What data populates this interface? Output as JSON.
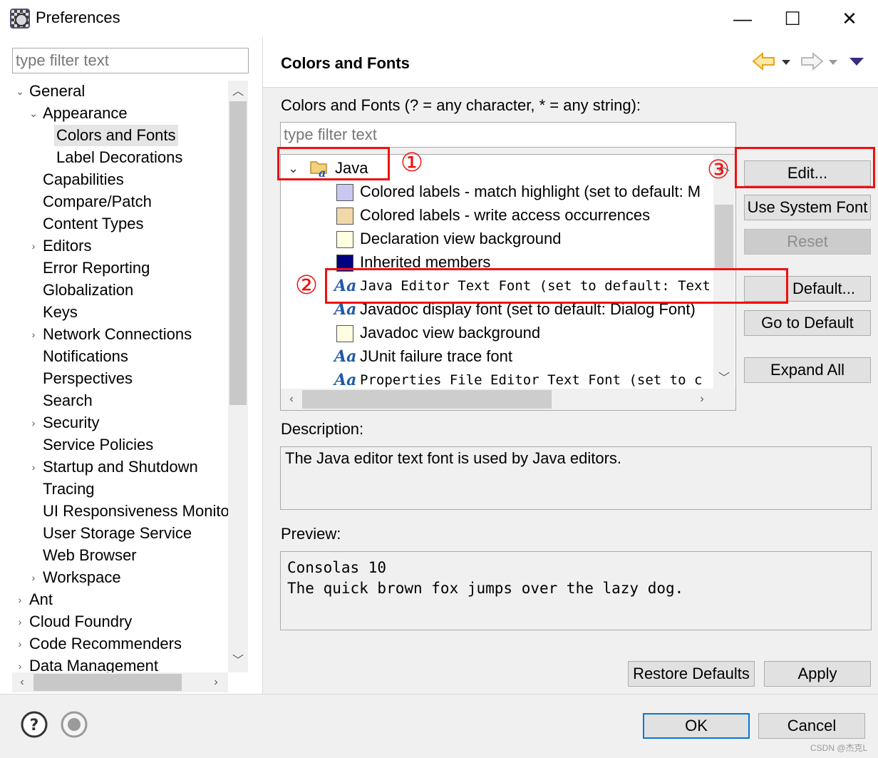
{
  "window": {
    "title": "Preferences",
    "controls": {
      "minimize": "—",
      "maximize": "☐",
      "close": "✕"
    }
  },
  "left": {
    "filter_placeholder": "type filter text",
    "tree": [
      {
        "label": "General",
        "level": 0,
        "state": "expanded"
      },
      {
        "label": "Appearance",
        "level": 1,
        "state": "expanded"
      },
      {
        "label": "Colors and Fonts",
        "level": 2,
        "state": "leaf",
        "selected": true
      },
      {
        "label": "Label Decorations",
        "level": 2,
        "state": "leaf"
      },
      {
        "label": "Capabilities",
        "level": 1,
        "state": "leaf"
      },
      {
        "label": "Compare/Patch",
        "level": 1,
        "state": "leaf"
      },
      {
        "label": "Content Types",
        "level": 1,
        "state": "leaf"
      },
      {
        "label": "Editors",
        "level": 1,
        "state": "collapsed"
      },
      {
        "label": "Error Reporting",
        "level": 1,
        "state": "leaf"
      },
      {
        "label": "Globalization",
        "level": 1,
        "state": "leaf"
      },
      {
        "label": "Keys",
        "level": 1,
        "state": "leaf"
      },
      {
        "label": "Network Connections",
        "level": 1,
        "state": "collapsed"
      },
      {
        "label": "Notifications",
        "level": 1,
        "state": "leaf"
      },
      {
        "label": "Perspectives",
        "level": 1,
        "state": "leaf"
      },
      {
        "label": "Search",
        "level": 1,
        "state": "leaf"
      },
      {
        "label": "Security",
        "level": 1,
        "state": "collapsed"
      },
      {
        "label": "Service Policies",
        "level": 1,
        "state": "leaf"
      },
      {
        "label": "Startup and Shutdown",
        "level": 1,
        "state": "collapsed"
      },
      {
        "label": "Tracing",
        "level": 1,
        "state": "leaf"
      },
      {
        "label": "UI Responsiveness Monito",
        "level": 1,
        "state": "leaf"
      },
      {
        "label": "User Storage Service",
        "level": 1,
        "state": "leaf"
      },
      {
        "label": "Web Browser",
        "level": 1,
        "state": "leaf"
      },
      {
        "label": "Workspace",
        "level": 1,
        "state": "collapsed"
      },
      {
        "label": "Ant",
        "level": 0,
        "state": "collapsed"
      },
      {
        "label": "Cloud Foundry",
        "level": 0,
        "state": "collapsed"
      },
      {
        "label": "Code Recommenders",
        "level": 0,
        "state": "collapsed"
      },
      {
        "label": "Data Management",
        "level": 0,
        "state": "collapsed"
      }
    ]
  },
  "page": {
    "title": "Colors and Fonts",
    "filter_label": "Colors and Fonts (? = any character, * = any string):",
    "filter_placeholder": "type filter text",
    "category": "Java",
    "items": [
      {
        "label": "Colored labels - match highlight (set to default: M",
        "kind": "color",
        "color": "#c8c8f0"
      },
      {
        "label": "Colored labels - write access occurrences",
        "kind": "color",
        "color": "#f0d8a8"
      },
      {
        "label": "Declaration view background",
        "kind": "color",
        "color": "#fffde0"
      },
      {
        "label": "Inherited members",
        "kind": "color",
        "color": "#000080"
      },
      {
        "label": "Java Editor Text Font (set to default: Text Font)",
        "kind": "font",
        "mono": true,
        "selected": true
      },
      {
        "label": "Javadoc display font (set to default: Dialog Font)",
        "kind": "font"
      },
      {
        "label": "Javadoc view background",
        "kind": "color",
        "color": "#fffde0"
      },
      {
        "label": "JUnit failure trace font",
        "kind": "font"
      },
      {
        "label": "Properties File Editor Text Font (set to c",
        "kind": "font",
        "mono": true
      }
    ],
    "buttons": {
      "edit": "Edit...",
      "use_system_font": "Use System Font",
      "reset": "Reset",
      "edit_default": "Default...",
      "go_to_default": "Go to Default",
      "expand_all": "Expand All"
    },
    "description_label": "Description:",
    "description": "The Java editor text font is used by Java editors.",
    "preview_label": "Preview:",
    "preview_lines": [
      "Consolas 10",
      "The quick brown fox jumps over the lazy dog."
    ],
    "restore_defaults": "Restore Defaults",
    "apply": "Apply"
  },
  "footer": {
    "ok": "OK",
    "cancel": "Cancel"
  },
  "annotations": {
    "one": "①",
    "two": "②",
    "three": "③"
  },
  "watermark": "CSDN @杰克L",
  "colors": {
    "annotation": "#f01010",
    "aa_icon": "#1f5aa6",
    "nav_arrow": "#e8a317",
    "selection": "#e5e5e5"
  }
}
